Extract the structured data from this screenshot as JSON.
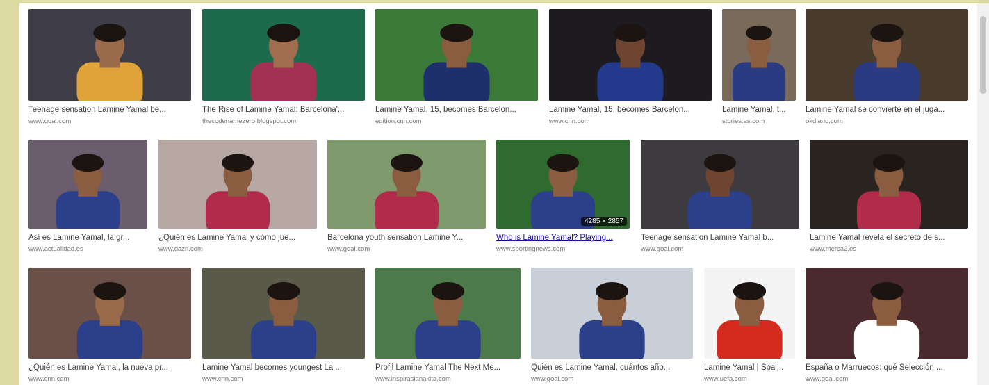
{
  "results": [
    {
      "caption": "Teenage sensation Lamine Yamal be...",
      "source": "www.goal.com",
      "bg": "#3f3d48",
      "shirt": "#e0a33a",
      "skin": "#9a6a4a"
    },
    {
      "caption": "The Rise of Lamine Yamal: Barcelona'...",
      "source": "thecodenamezero.blogspot.com",
      "bg": "#1e6a4f",
      "shirt": "#a23154",
      "skin": "#a06e4e"
    },
    {
      "caption": "Lamine Yamal, 15, becomes Barcelon...",
      "source": "edition.cnn.com",
      "bg": "#3c7a3a",
      "shirt": "#1e2f6e",
      "skin": "#8a5c40"
    },
    {
      "caption": "Lamine Yamal, 15, becomes Barcelon...",
      "source": "www.cnn.com",
      "bg": "#1d1a20",
      "shirt": "#233a8c",
      "skin": "#6e4530"
    },
    {
      "caption": "Lamine Yamal, t...",
      "source": "stories.as.com",
      "bg": "#7a6a5a",
      "shirt": "#2a3b82",
      "skin": "#8a5c40"
    },
    {
      "caption": "Lamine Yamal se convierte en el juga...",
      "source": "okdiario.com",
      "bg": "#4a3c2c",
      "shirt": "#2a3b82",
      "skin": "#8a5c40"
    },
    {
      "caption": "Así es Lamine Yamal, la gr...",
      "source": "www.actualidad.es",
      "bg": "#6b5d6e",
      "shirt": "#2b3f8a",
      "skin": "#8a5c40"
    },
    {
      "caption": "¿Quién es Lamine Yamal y cómo jue...",
      "source": "www.dazn.com",
      "bg": "#b7a8a4",
      "shirt": "#b02c4a",
      "skin": "#8a5c40"
    },
    {
      "caption": "Barcelona youth sensation Lamine Y...",
      "source": "www.goal.com",
      "bg": "#7f9a6c",
      "shirt": "#b02c4a",
      "skin": "#8a5c40"
    },
    {
      "caption": "Who is Lamine Yamal? Playing...",
      "source": "www.sportingnews.com",
      "bg": "#2f6a2e",
      "shirt": "#2b3f8a",
      "skin": "#8a5c40",
      "dimensions": "4285 × 2857",
      "link": true
    },
    {
      "caption": "Teenage sensation Lamine Yamal b...",
      "source": "www.goal.com",
      "bg": "#3d3a40",
      "shirt": "#2b3f8a",
      "skin": "#6e4530"
    },
    {
      "caption": "Lamine Yamal revela el secreto de s...",
      "source": "www.merca2.es",
      "bg": "#2a2420",
      "shirt": "#b02c4a",
      "skin": "#8a5c40"
    },
    {
      "caption": "¿Quién es Lamine Yamal, la nueva pr...",
      "source": "www.cnn.com",
      "bg": "#6a5048",
      "shirt": "#2b3f8a",
      "skin": "#9a6a4a"
    },
    {
      "caption": "Lamine Yamal becomes youngest La ...",
      "source": "www.cnn.com",
      "bg": "#5a5a4a",
      "shirt": "#2b3f8a",
      "skin": "#8a5c40"
    },
    {
      "caption": "Profil Lamine Yamal The Next Me...",
      "source": "www.inspirasianakita.com",
      "bg": "#4d7a4a",
      "shirt": "#2b3f8a",
      "skin": "#8a5c40"
    },
    {
      "caption": "Quién es Lamine Yamal, cuántos año...",
      "source": "www.goal.com",
      "bg": "#c8cfd8",
      "shirt": "#2b3f8a",
      "skin": "#8a5c40"
    },
    {
      "caption": "Lamine Yamal | Spai...",
      "source": "www.uefa.com",
      "bg": "#f4f4f4",
      "shirt": "#d52b1e",
      "skin": "#8a5c40"
    },
    {
      "caption": "España o Marruecos: qué Selección ...",
      "source": "www.goal.com",
      "bg": "#4a2a2c",
      "shirt": "#ffffff",
      "skin": "#8a5c40"
    }
  ]
}
